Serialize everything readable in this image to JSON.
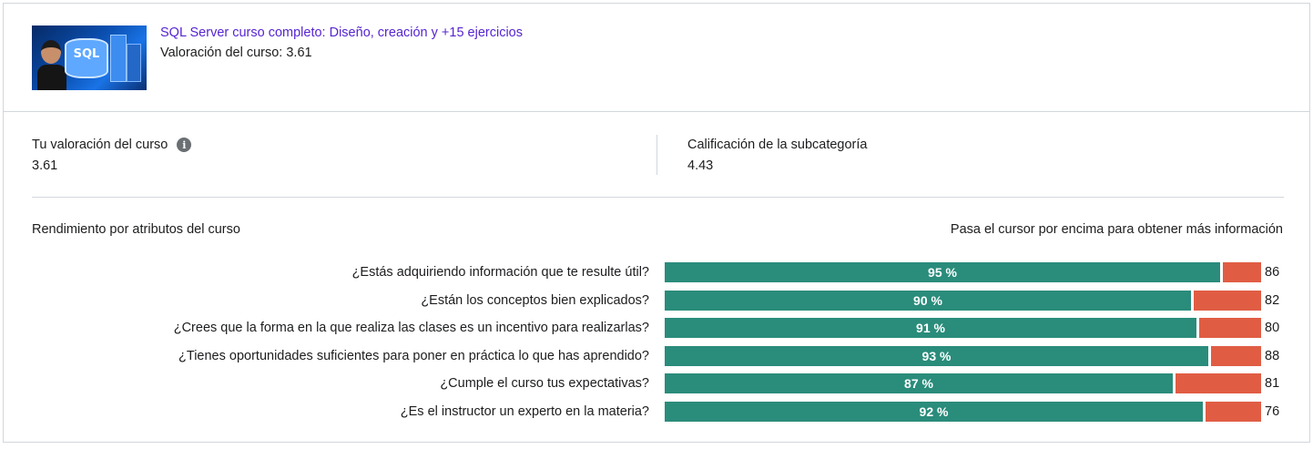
{
  "course": {
    "title": "SQL Server curso completo: Diseño, creación y +15 ejercicios",
    "rating_line": "Valoración del curso: 3.61",
    "thumbnail_text": "SQL"
  },
  "stats": {
    "your_rating_label": "Tu valoración del curso",
    "your_rating_value": "3.61",
    "subcategory_label": "Calificación de la subcategoría",
    "subcategory_value": "4.43"
  },
  "attributes": {
    "title": "Rendimiento por atributos del curso",
    "hint": "Pasa el cursor por encima para obtener más información",
    "colors": {
      "positive": "#2a8c7b",
      "negative": "#e05d44"
    },
    "rows": [
      {
        "question": "¿Estás adquiriendo información que te resulte útil?",
        "pct": 95,
        "pct_label": "95 %",
        "count": "86"
      },
      {
        "question": "¿Están los conceptos bien explicados?",
        "pct": 90,
        "pct_label": "90 %",
        "count": "82"
      },
      {
        "question": "¿Crees que la forma en la que realiza las clases es un incentivo para realizarlas?",
        "pct": 91,
        "pct_label": "91 %",
        "count": "80"
      },
      {
        "question": "¿Tienes oportunidades suficientes para poner en práctica lo que has aprendido?",
        "pct": 93,
        "pct_label": "93 %",
        "count": "88"
      },
      {
        "question": "¿Cumple el curso tus expectativas?",
        "pct": 87,
        "pct_label": "87 %",
        "count": "81"
      },
      {
        "question": "¿Es el instructor un experto en la materia?",
        "pct": 92,
        "pct_label": "92 %",
        "count": "76"
      }
    ]
  }
}
